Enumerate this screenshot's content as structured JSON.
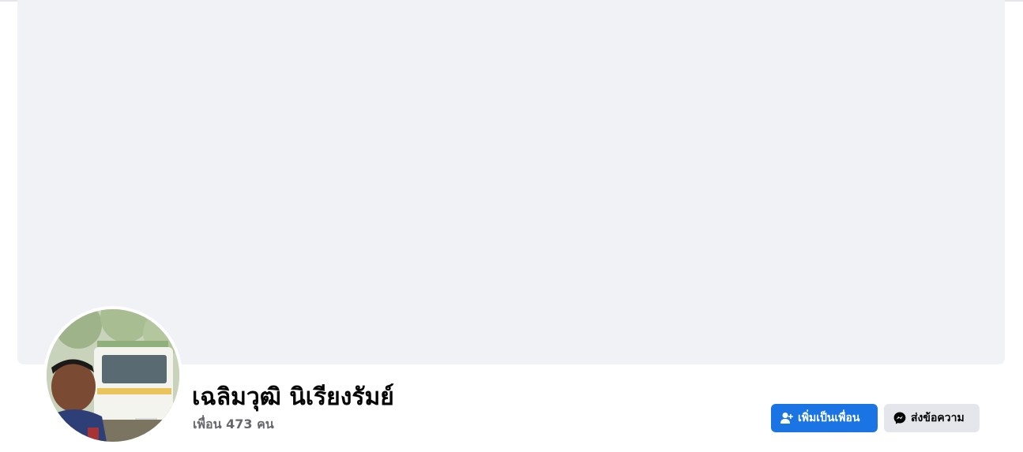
{
  "profile": {
    "name": "เฉลิมวุฒิ นิเรียงรัมย์",
    "friends_text": "เพื่อน 473 คน"
  },
  "actions": {
    "add_friend_label": "เพิ่มเป็นเพื่อน",
    "add_friend_icon": "add-person-icon",
    "message_label": "ส่งข้อความ",
    "message_icon": "messenger-icon"
  },
  "colors": {
    "cover": "#f0f2f5",
    "primary_button": "#1b74e4",
    "secondary_button": "#e4e6eb",
    "secondary_text": "#65676b"
  }
}
